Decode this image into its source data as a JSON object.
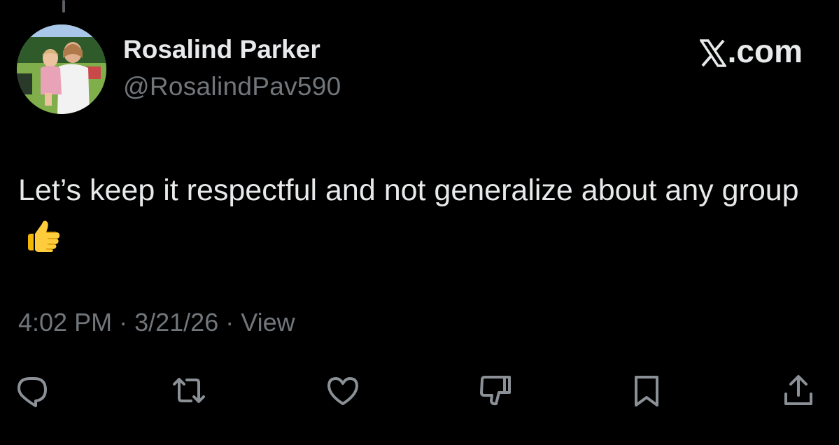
{
  "author": {
    "display_name": "Rosalind Parker",
    "handle": "@RosalindPav590",
    "avatar_alt": "profile-photo"
  },
  "brand": {
    "label": ".com",
    "icon": "x-logo-icon"
  },
  "tweet": {
    "text": "Let’s keep it respectful and not generalize about any group",
    "emoji": "thumbs-up-icon"
  },
  "meta": {
    "time": "4:02 PM",
    "separator": "·",
    "date": "3/21/26",
    "view_label": "View"
  },
  "actions": [
    {
      "name": "reply",
      "icon": "reply-icon"
    },
    {
      "name": "repost",
      "icon": "repost-icon"
    },
    {
      "name": "like",
      "icon": "heart-icon"
    },
    {
      "name": "dislike",
      "icon": "thumbs-down-icon"
    },
    {
      "name": "bookmark",
      "icon": "bookmark-icon"
    },
    {
      "name": "share",
      "icon": "share-icon"
    }
  ],
  "colors": {
    "background": "#000000",
    "primary_text": "#e7e9ea",
    "secondary_text": "#71767b",
    "icon": "#8b9096"
  }
}
